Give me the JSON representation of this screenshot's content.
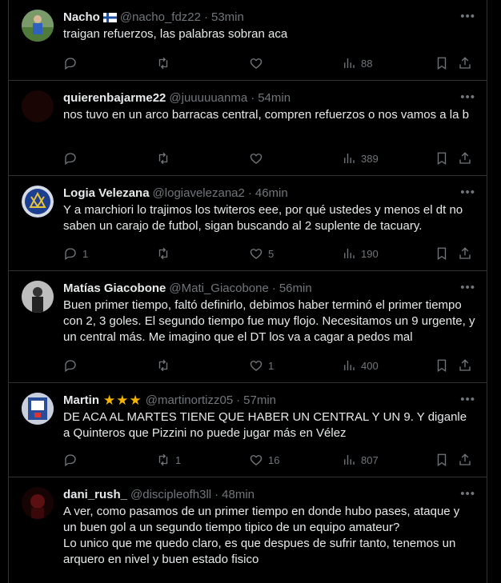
{
  "tweets": [
    {
      "name": "Nacho",
      "badge": "finland-flag",
      "handle": "@nacho_fdz22",
      "time": "53min",
      "text": "traigan refuerzos, las palabras sobran aca",
      "replies": "",
      "retweets": "",
      "likes": "",
      "views": "88",
      "avatar_color": "#3b5e8c"
    },
    {
      "name": "quierenbajarme22",
      "badge": "",
      "handle": "@juuuuuanma",
      "time": "54min",
      "text": "nos tuvo en un arco barracas central, compren refuerzos o nos vamos a la b",
      "replies": "",
      "retweets": "",
      "likes": "",
      "views": "389",
      "avatar_color": "#1a0505"
    },
    {
      "name": "Logia Velezana",
      "badge": "",
      "handle": "@logiavelezana2",
      "time": "46min",
      "text": "Y a marchiori lo trajimos los twiteros eee, por qué ustedes y menos el dt no saben un carajo de futbol, sigan buscando al 2 suplente de tacuary.",
      "replies": "1",
      "retweets": "",
      "likes": "5",
      "views": "190",
      "avatar_color": "#1c3f8f"
    },
    {
      "name": "Matías Giacobone",
      "badge": "",
      "handle": "@Mati_Giacobone",
      "time": "56min",
      "text": "Buen primer tiempo, faltó definirlo, debimos haber terminó el primer tiempo con 2, 3 goles. El segundo tiempo fue muy flojo. Necesitamos un 9 urgente, y un central más. Me imagino que el DT los va a cagar a pedos mal",
      "replies": "",
      "retweets": "",
      "likes": "1",
      "views": "400",
      "avatar_color": "#777777"
    },
    {
      "name": "Martin",
      "badge": "stars",
      "stars": "★★★",
      "handle": "@martinortizz05",
      "time": "57min",
      "text": "DE ACA AL MARTES TIENE QUE HABER UN CENTRAL Y UN 9. Y diganle a Quinteros que Pizzini no puede jugar más en Vélez",
      "replies": "",
      "retweets": "1",
      "likes": "16",
      "views": "807",
      "avatar_color": "#8fa2c9"
    },
    {
      "name": "dani_rush_",
      "badge": "",
      "handle": "@discipleofh3ll",
      "time": "48min",
      "text": "A ver, como pasamos de un primer tiempo en donde hubo pases, ataque y un buen gol a un segundo tiempo tipico de un equipo amateur?\nLo unico que me quedo claro, es que despues de sufrir tanto, tenemos un arquero en nivel y buen estado fisico",
      "replies": "",
      "retweets": "",
      "likes": "",
      "views": "",
      "avatar_color": "#2a0808"
    }
  ],
  "icons": {
    "more": "more-icon",
    "reply": "reply-icon",
    "retweet": "retweet-icon",
    "like": "like-icon",
    "views": "views-icon",
    "bookmark": "bookmark-icon",
    "share": "share-icon"
  },
  "colors": {
    "background": "#000000",
    "text": "#e7e9ea",
    "muted": "#71767b",
    "border": "#2f3336",
    "star": "#f5b400"
  }
}
